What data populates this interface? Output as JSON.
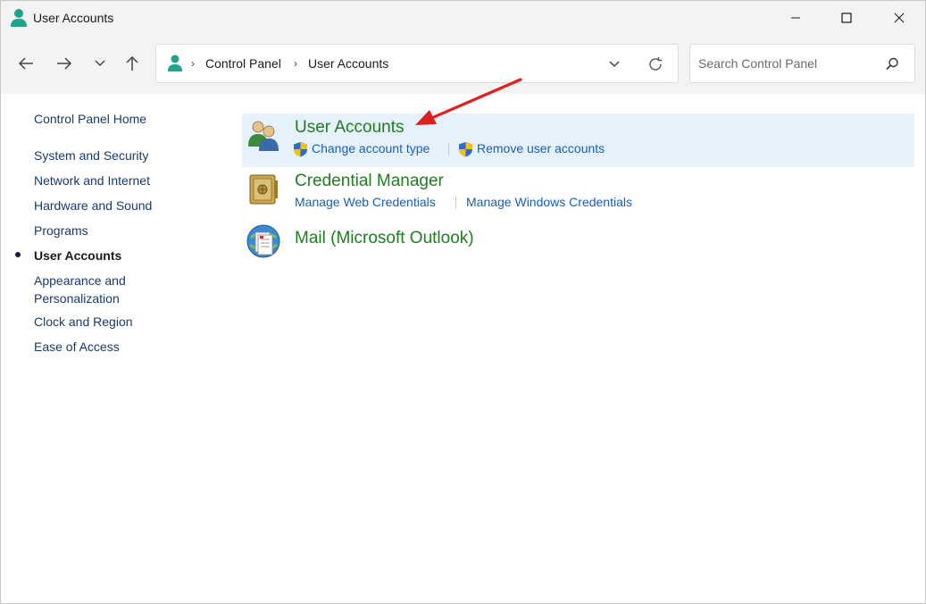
{
  "window": {
    "title": "User Accounts",
    "controls": [
      "minimize",
      "maximize",
      "close"
    ]
  },
  "navigation": {
    "buttons": [
      "back",
      "forward",
      "recent-locations",
      "up"
    ],
    "breadcrumb": [
      "Control Panel",
      "User Accounts"
    ]
  },
  "search": {
    "placeholder": "Search Control Panel"
  },
  "sidebar": {
    "items": [
      {
        "label": "Control Panel Home"
      },
      {
        "label": "System and Security"
      },
      {
        "label": "Network and Internet"
      },
      {
        "label": "Hardware and Sound"
      },
      {
        "label": "Programs"
      },
      {
        "label": "User Accounts",
        "active": true
      },
      {
        "label": "Appearance and"
      },
      {
        "label": "Personalization"
      },
      {
        "label": "Clock and Region"
      },
      {
        "label": "Ease of Access"
      }
    ]
  },
  "categories": [
    {
      "title": "User Accounts",
      "icon": "users-icon",
      "highlighted": true,
      "links": [
        "Change account type",
        "Remove user accounts"
      ]
    },
    {
      "title": "Credential Manager",
      "icon": "vault-icon",
      "links": [
        "Manage Web Credentials",
        "Manage Windows Credentials"
      ]
    },
    {
      "title": "Mail (Microsoft Outlook)",
      "icon": "mail-icon",
      "links": []
    }
  ],
  "colors": {
    "category_title": "#1e7e1e",
    "link": "#1a5fb4",
    "highlight": "#e5f1fb",
    "annotation_arrow": "#e02020"
  }
}
